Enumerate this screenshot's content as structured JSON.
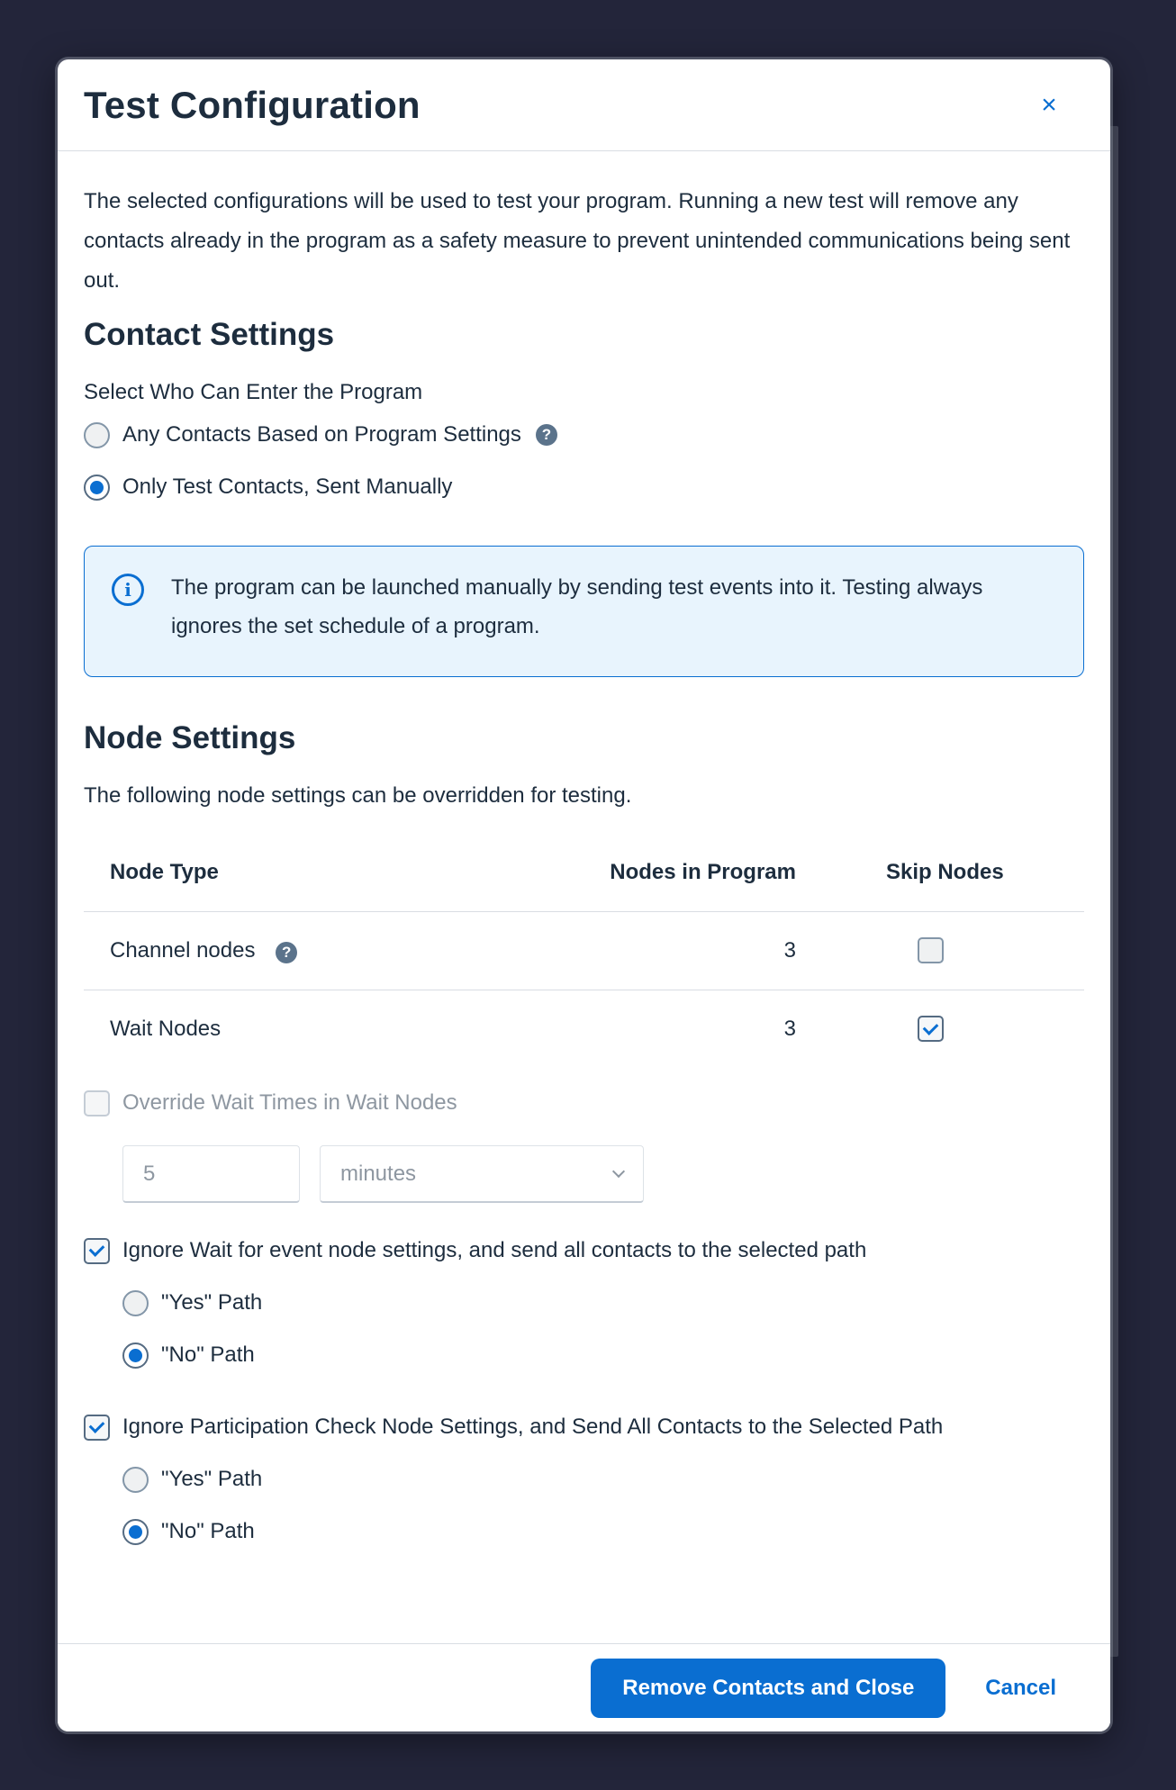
{
  "dialog": {
    "title": "Test Configuration",
    "close_icon": "×",
    "description": "The selected configurations will be used to test your program. Running a new test will remove any contacts already in the program as a safety measure to prevent unintended communications being sent out."
  },
  "contact_settings": {
    "heading": "Contact Settings",
    "label": "Select Who Can Enter the Program",
    "options": [
      {
        "label": "Any Contacts Based on Program Settings",
        "checked": false
      },
      {
        "label": "Only Test Contacts, Sent Manually",
        "checked": true
      }
    ],
    "info": "The program can be launched manually by sending test events into it. Testing always ignores the set schedule of a program."
  },
  "node_settings": {
    "heading": "Node Settings",
    "description": "The following node settings can be overridden for testing.",
    "columns": [
      "Node Type",
      "Nodes in Program",
      "Skip Nodes"
    ],
    "rows": [
      {
        "type": "Channel nodes",
        "count": "3",
        "skip": false
      },
      {
        "type": "Wait Nodes",
        "count": "3",
        "skip": true
      }
    ],
    "override_wait": {
      "label": "Override Wait Times in Wait Nodes",
      "checked": false,
      "value": "5",
      "unit": "minutes"
    },
    "ignore_wait_event": {
      "label": "Ignore Wait for event node settings, and send all contacts to the selected path",
      "checked": true,
      "yes_label": "\"Yes\" Path",
      "no_label": "\"No\" Path",
      "selected": "no"
    },
    "ignore_participation": {
      "label": "Ignore Participation Check Node Settings, and Send All Contacts to the Selected Path",
      "checked": true,
      "yes_label": "\"Yes\" Path",
      "no_label": "\"No\" Path",
      "selected": "no"
    }
  },
  "footer": {
    "primary_label": "Remove Contacts and Close",
    "cancel_label": "Cancel"
  },
  "colors": {
    "accent": "#0a6ed1",
    "info_background": "#e8f4fd",
    "backdrop": "#23253a"
  },
  "icons": {
    "close": "close-icon",
    "help": "question-circle-icon",
    "info": "info-circle-icon",
    "dropdown": "chevron-down-icon"
  }
}
